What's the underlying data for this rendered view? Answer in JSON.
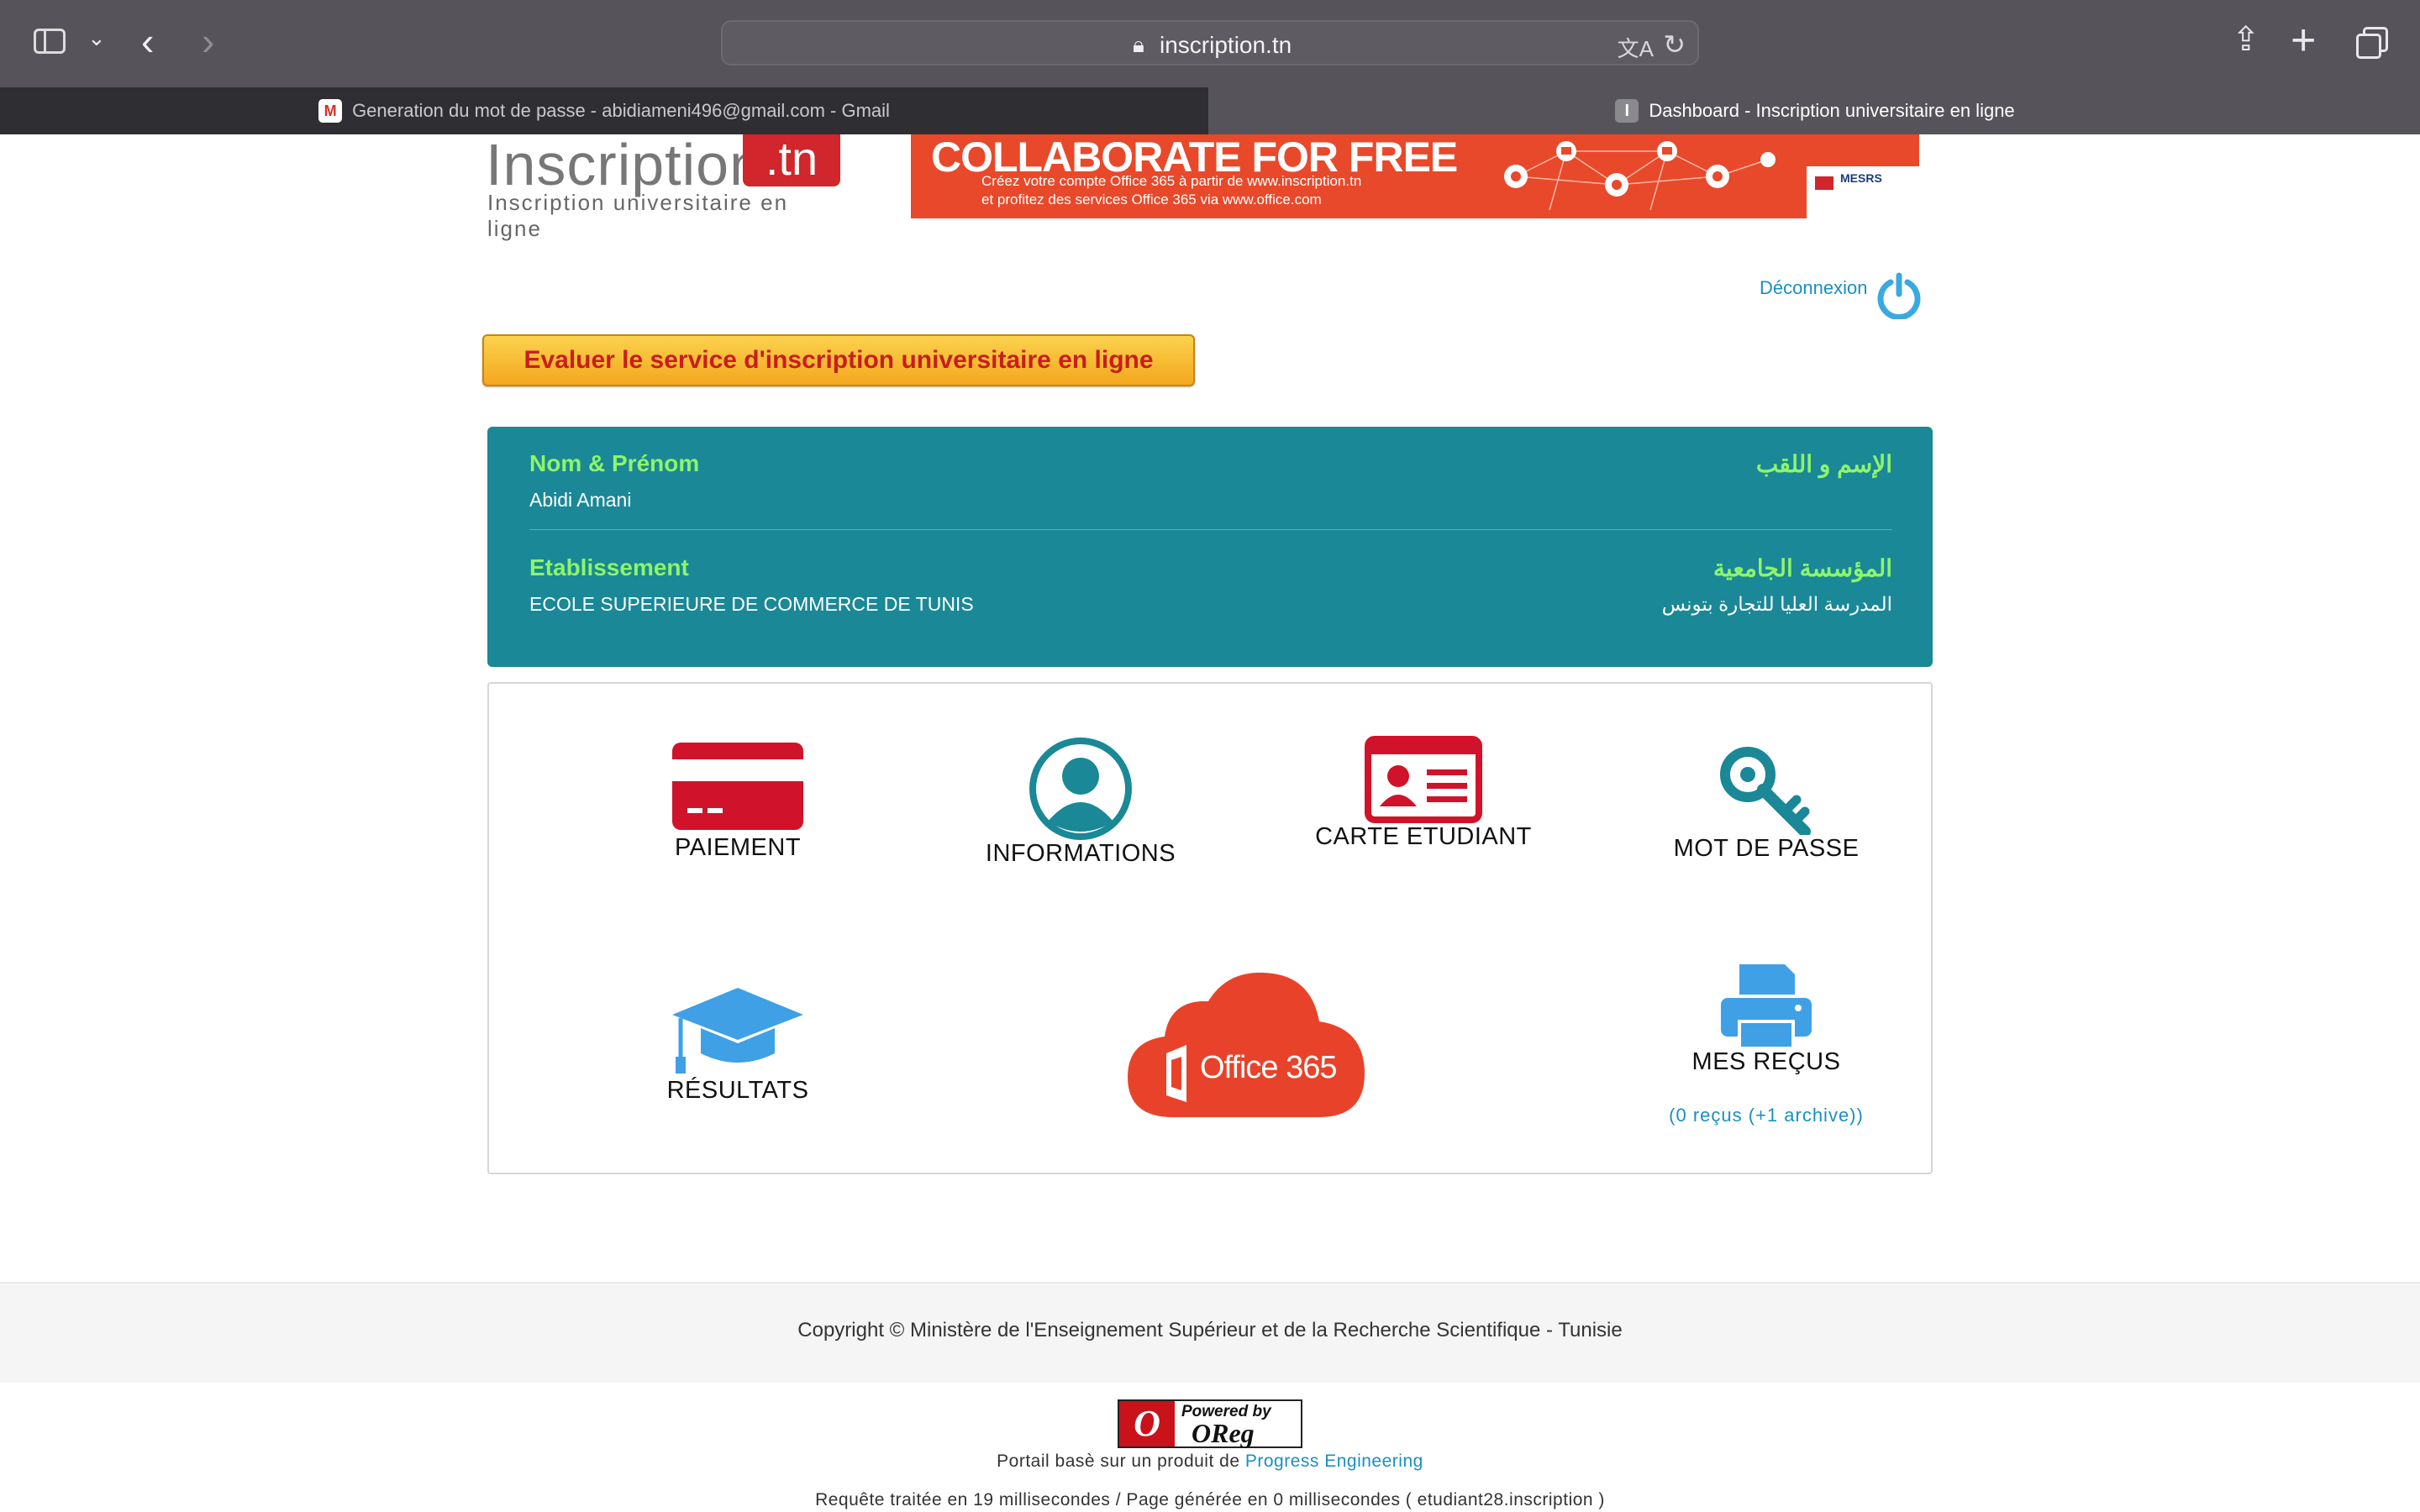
{
  "browser": {
    "url": "inscription.tn",
    "tabs": [
      {
        "title": "Generation du mot de passe - abidiameni496@gmail.com - Gmail",
        "favicon": "gmail-icon",
        "active": false
      },
      {
        "title": "Dashboard - Inscription universitaire en ligne",
        "favicon": "I",
        "active": true
      }
    ]
  },
  "header": {
    "logo_main": "Inscription",
    "logo_tn": ".tn",
    "logo_sub": "Inscription universitaire en ligne",
    "banner_title": "COLLABORATE FOR FREE",
    "banner_line1": "Créez votre compte Office 365 à partir de www.inscription.tn",
    "banner_line2": "et profitez des services Office 365 via www.office.com",
    "banner_badge": "MESRS"
  },
  "logout_label": "Déconnexion",
  "eval_button": "Evaluer le service d'inscription universitaire en ligne",
  "student": {
    "name_label_fr": "Nom & Prénom",
    "name_label_ar": "الإسم و اللقب",
    "name": "Abidi Amani",
    "etab_label_fr": "Etablissement",
    "etab_label_ar": "المؤسسة الجامعية",
    "etab_fr": "ECOLE SUPERIEURE DE COMMERCE DE TUNIS",
    "etab_ar": "المدرسة العليا للتجارة بتونس"
  },
  "menu": {
    "paiement": "PAIEMENT",
    "informations": "INFORMATIONS",
    "carte": "CARTE ETUDIANT",
    "motdepasse": "MOT DE PASSE",
    "resultats": "RÉSULTATS",
    "office": "Office 365",
    "recus": "MES REÇUS",
    "recus_count": "(0 reçus (+1 archive))"
  },
  "footer": {
    "copyright": "Copyright © Ministère de l'Enseignement Supérieur et de la Recherche Scientifique - Tunisie",
    "powered_by": "Powered by",
    "oreg": "OReg",
    "portail_text": "Portail basè sur un produit de",
    "portail_link": "Progress Engineering",
    "requete": "Requête traitée en 19 millisecondes / Page générée en 0 millisecondes ( etudiant28.inscription )"
  },
  "colors": {
    "accent_teal": "#1a8896",
    "label_green": "#8df56a",
    "brand_red": "#d0262c",
    "link_blue": "#1a8fc0",
    "office_orange": "#e8432a"
  }
}
